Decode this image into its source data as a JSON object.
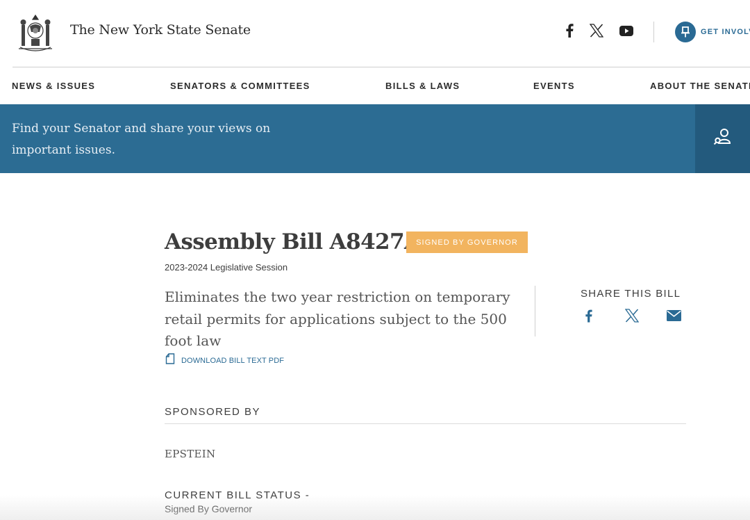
{
  "header": {
    "site_title": "The New York State Senate",
    "get_involved_label": "GET INVOLVED",
    "social_icons": [
      "facebook-icon",
      "x-icon",
      "youtube-icon"
    ]
  },
  "nav": {
    "items": [
      "NEWS & ISSUES",
      "SENATORS & COMMITTEES",
      "BILLS & LAWS",
      "EVENTS",
      "ABOUT THE SENATE"
    ]
  },
  "banner": {
    "text": "Find your Senator and share your views on important issues.",
    "icon": "find-senator-icon"
  },
  "bill": {
    "title": "Assembly Bill A8427A",
    "status_badge": "SIGNED BY GOVERNOR",
    "session": "2023-2024 Legislative Session",
    "summary": "Eliminates the two year restriction on temporary retail permits for applications subject to the 500 foot law",
    "download_label": "DOWNLOAD BILL TEXT PDF"
  },
  "share": {
    "title": "SHARE THIS BILL",
    "icons": [
      "facebook-icon",
      "x-icon",
      "email-icon"
    ]
  },
  "sponsor": {
    "heading": "SPONSORED BY",
    "name": "EPSTEIN"
  },
  "status": {
    "heading": "CURRENT BILL STATUS -",
    "value": "Signed By Governor"
  },
  "colors": {
    "brand_blue": "#2c6c93",
    "banner_button": "#235a7d",
    "badge_orange": "#f2b45f",
    "link_blue": "#2a6a94"
  }
}
